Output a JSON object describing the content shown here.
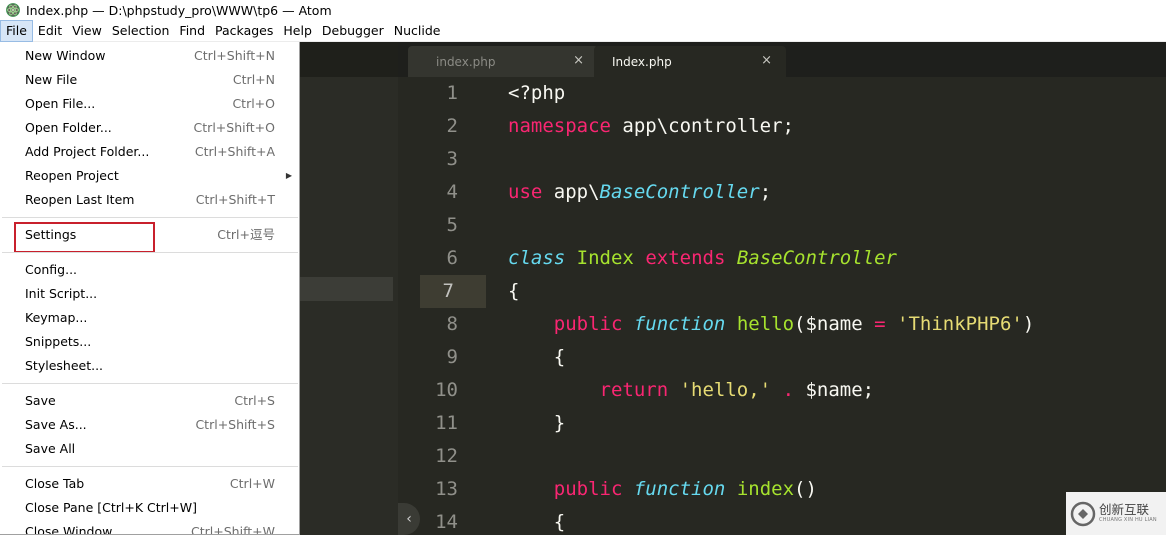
{
  "window": {
    "title": "Index.php — D:\\phpstudy_pro\\WWW\\tp6 — Atom"
  },
  "menubar": {
    "items": [
      "File",
      "Edit",
      "View",
      "Selection",
      "Find",
      "Packages",
      "Help",
      "Debugger",
      "Nuclide"
    ],
    "active": "File"
  },
  "tabs": [
    {
      "label": "index.php",
      "close": "×",
      "active": false
    },
    {
      "label": "Index.php",
      "close": "×",
      "active": true
    }
  ],
  "file_menu": {
    "groups": [
      [
        {
          "label": "New Window",
          "accel": "Ctrl+Shift+N"
        },
        {
          "label": "New File",
          "accel": "Ctrl+N"
        },
        {
          "label": "Open File...",
          "accel": "Ctrl+O"
        },
        {
          "label": "Open Folder...",
          "accel": "Ctrl+Shift+O"
        },
        {
          "label": "Add Project Folder...",
          "accel": "Ctrl+Shift+A"
        },
        {
          "label": "Reopen Project",
          "accel": "",
          "submenu": true
        },
        {
          "label": "Reopen Last Item",
          "accel": "Ctrl+Shift+T"
        }
      ],
      [
        {
          "label": "Settings",
          "accel": "Ctrl+逗号",
          "highlighted": true
        }
      ],
      [
        {
          "label": "Config...",
          "accel": ""
        },
        {
          "label": "Init Script...",
          "accel": ""
        },
        {
          "label": "Keymap...",
          "accel": ""
        },
        {
          "label": "Snippets...",
          "accel": ""
        },
        {
          "label": "Stylesheet...",
          "accel": ""
        }
      ],
      [
        {
          "label": "Save",
          "accel": "Ctrl+S"
        },
        {
          "label": "Save As...",
          "accel": "Ctrl+Shift+S"
        },
        {
          "label": "Save All",
          "accel": ""
        }
      ],
      [
        {
          "label": "Close Tab",
          "accel": "Ctrl+W"
        },
        {
          "label": "Close Pane [Ctrl+K Ctrl+W]",
          "accel": ""
        },
        {
          "label": "Close Window",
          "accel": "Ctrl+Shift+W"
        }
      ]
    ]
  },
  "editor": {
    "current_line": 7,
    "lines": [
      {
        "n": "1",
        "tokens": [
          [
            "<?php",
            "plain"
          ]
        ]
      },
      {
        "n": "2",
        "tokens": [
          [
            "namespace",
            "kw"
          ],
          [
            " app\\controller;",
            "plain"
          ]
        ]
      },
      {
        "n": "3",
        "tokens": []
      },
      {
        "n": "4",
        "tokens": [
          [
            "use",
            "kw"
          ],
          [
            " app\\",
            "plain"
          ],
          [
            "BaseController",
            "type"
          ],
          [
            ";",
            "plain"
          ]
        ]
      },
      {
        "n": "5",
        "tokens": []
      },
      {
        "n": "6",
        "tokens": [
          [
            "class",
            "type"
          ],
          [
            " ",
            "plain"
          ],
          [
            "Index",
            "cls"
          ],
          [
            " ",
            "plain"
          ],
          [
            "extends",
            "kw"
          ],
          [
            " ",
            "plain"
          ],
          [
            "BaseController",
            "cls-i"
          ]
        ]
      },
      {
        "n": "7",
        "tokens": [
          [
            "{",
            "plain"
          ]
        ]
      },
      {
        "n": "8",
        "tokens": [
          [
            "    ",
            "plain"
          ],
          [
            "public",
            "kw"
          ],
          [
            " ",
            "plain"
          ],
          [
            "function",
            "type"
          ],
          [
            " ",
            "plain"
          ],
          [
            "hello",
            "fn"
          ],
          [
            "($name ",
            "plain"
          ],
          [
            "=",
            "op"
          ],
          [
            " ",
            "plain"
          ],
          [
            "'ThinkPHP6'",
            "str"
          ],
          [
            ")",
            "plain"
          ]
        ]
      },
      {
        "n": "9",
        "tokens": [
          [
            "    {",
            "plain"
          ]
        ]
      },
      {
        "n": "10",
        "tokens": [
          [
            "        ",
            "plain"
          ],
          [
            "return",
            "kw"
          ],
          [
            " ",
            "plain"
          ],
          [
            "'hello,'",
            "str"
          ],
          [
            " ",
            "plain"
          ],
          [
            ".",
            "op"
          ],
          [
            " $name;",
            "plain"
          ]
        ]
      },
      {
        "n": "11",
        "tokens": [
          [
            "    }",
            "plain"
          ]
        ]
      },
      {
        "n": "12",
        "tokens": []
      },
      {
        "n": "13",
        "tokens": [
          [
            "    ",
            "plain"
          ],
          [
            "public",
            "kw"
          ],
          [
            " ",
            "plain"
          ],
          [
            "function",
            "type"
          ],
          [
            " ",
            "plain"
          ],
          [
            "index",
            "fn"
          ],
          [
            "()",
            "plain"
          ]
        ]
      },
      {
        "n": "14",
        "tokens": [
          [
            "    {",
            "plain"
          ]
        ]
      }
    ],
    "collapse_glyph": "‹"
  },
  "watermark": {
    "cn": "创新互联",
    "en": "CHUANG XIN HU LIAN"
  },
  "colors": {
    "editor_bg": "#272822",
    "keyword": "#f92672",
    "type": "#66d9ef",
    "class": "#a6e22e",
    "string": "#e6db74",
    "highlight_box": "#c8202c"
  }
}
